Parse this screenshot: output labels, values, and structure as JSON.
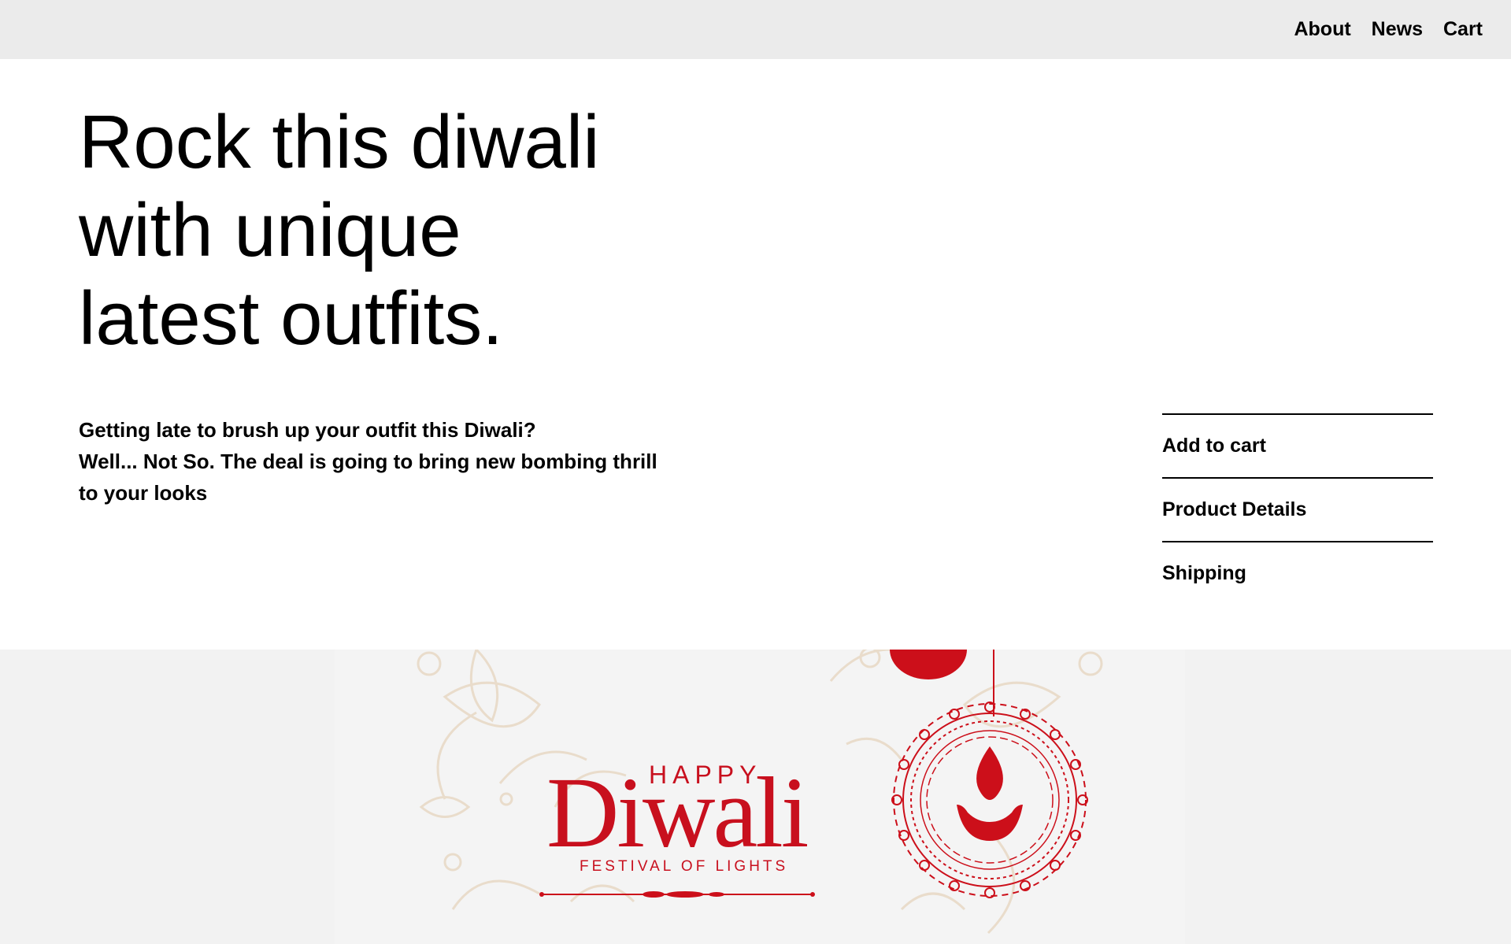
{
  "nav": {
    "about": "About",
    "news": "News",
    "cart": "Cart"
  },
  "hero": {
    "headline_line1": "Rock this diwali",
    "headline_line2": "with unique",
    "headline_line3": "latest outfits.",
    "intro_line1": "Getting late to brush up your outfit this Diwali?",
    "intro_line2": "Well... Not So. The deal is going to bring new bombing thrill to your looks"
  },
  "accordion": {
    "items": [
      "Add to cart",
      "Product Details",
      "Shipping"
    ]
  },
  "banner": {
    "happy": "HAPPY",
    "diwali": "Diwali",
    "festival": "FESTIVAL OF LIGHTS"
  },
  "colors": {
    "topbar": "#ebebeb",
    "accent_red": "#c8101e",
    "banner_bg": "#f4f4f4"
  }
}
